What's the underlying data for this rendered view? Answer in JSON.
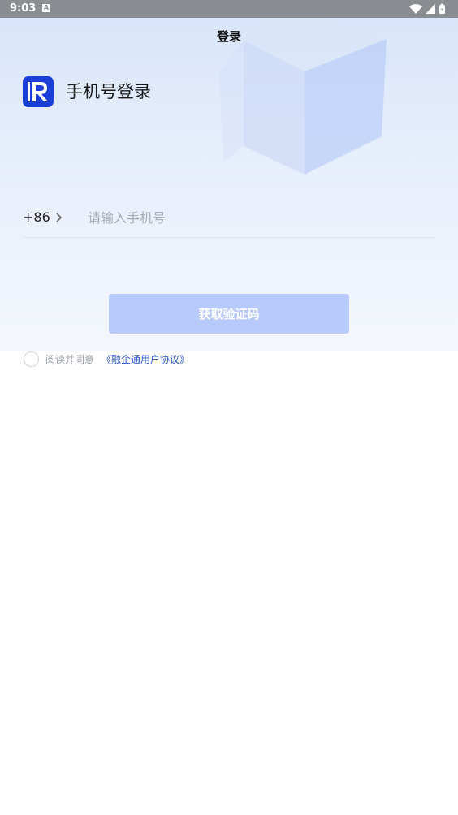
{
  "status_bar": {
    "time": "9:03",
    "notification_icon": "A"
  },
  "nav": {
    "title": "登录"
  },
  "brand": {
    "title": "手机号登录",
    "logo_icon": "R-logo-icon",
    "logo_color": "#1a3fd6"
  },
  "phone": {
    "country_code": "+86",
    "placeholder": "请输入手机号",
    "value": ""
  },
  "button": {
    "label": "获取验证码",
    "color": "#b8cafb"
  },
  "agreement": {
    "prefix": "阅读并同意",
    "link": "《融企通用户协议》",
    "link_color": "#2a55c9",
    "checked": false
  }
}
